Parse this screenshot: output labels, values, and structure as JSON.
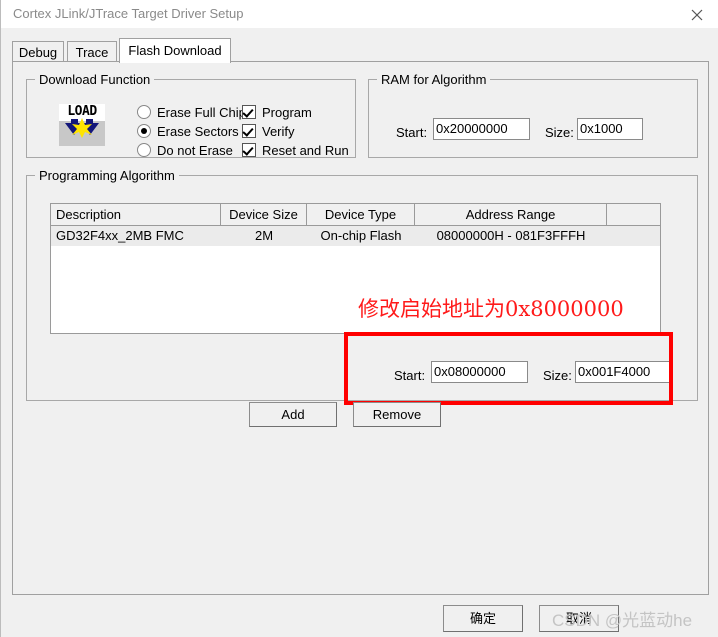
{
  "window": {
    "title": "Cortex JLink/JTrace Target Driver Setup",
    "close_icon": "close-icon"
  },
  "tabs": [
    {
      "label": "Debug",
      "active": false
    },
    {
      "label": "Trace",
      "active": false
    },
    {
      "label": "Flash Download",
      "active": true
    }
  ],
  "download_function": {
    "legend": "Download Function",
    "icon_text": "LOAD",
    "radios": [
      {
        "label": "Erase Full Chip",
        "selected": false
      },
      {
        "label": "Erase Sectors",
        "selected": true
      },
      {
        "label": "Do not Erase",
        "selected": false
      }
    ],
    "checkboxes": [
      {
        "label": "Program",
        "checked": true
      },
      {
        "label": "Verify",
        "checked": true
      },
      {
        "label": "Reset and Run",
        "checked": true
      }
    ]
  },
  "ram_for_algorithm": {
    "legend": "RAM for Algorithm",
    "start_label": "Start:",
    "start_value": "0x20000000",
    "size_label": "Size:",
    "size_value": "0x1000"
  },
  "programming_algorithm": {
    "legend": "Programming Algorithm",
    "columns": [
      "Description",
      "Device Size",
      "Device Type",
      "Address Range",
      ""
    ],
    "rows": [
      {
        "description": "GD32F4xx_2MB FMC",
        "device_size": "2M",
        "device_type": "On-chip Flash",
        "address_range": "08000000H - 081F3FFFH"
      }
    ],
    "start_label": "Start:",
    "start_value": "0x08000000",
    "size_label": "Size:",
    "size_value": "0x001F4000",
    "add_label": "Add",
    "remove_label": "Remove"
  },
  "annotation": {
    "red_note": "修改启始地址为0x8000000",
    "highlight_color": "#ff0000",
    "note_color": "#ff1a1a"
  },
  "footer": {
    "ok_label": "确定",
    "cancel_label": "取消",
    "watermark": "CSDN @光蓝动he"
  }
}
